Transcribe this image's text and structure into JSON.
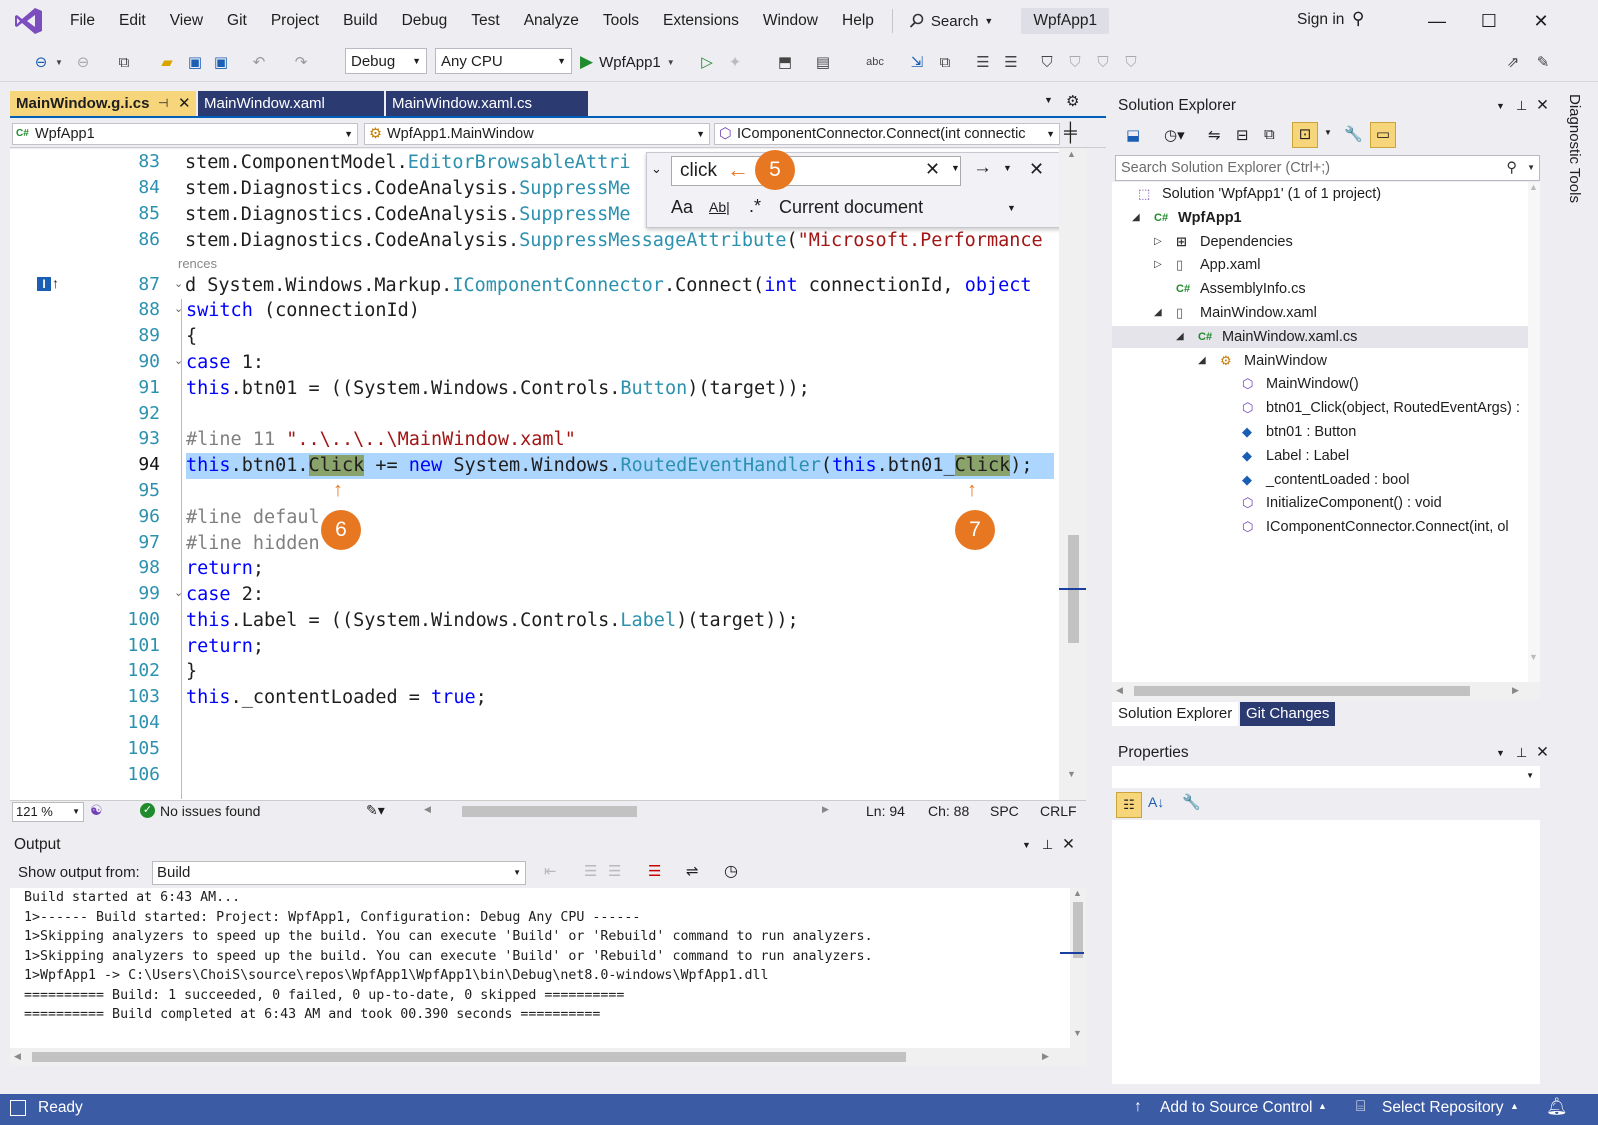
{
  "menubar": {
    "items": [
      "File",
      "Edit",
      "View",
      "Git",
      "Project",
      "Build",
      "Debug",
      "Test",
      "Analyze",
      "Tools",
      "Extensions",
      "Window",
      "Help"
    ],
    "search_label": "Search",
    "app_title": "WpfApp1",
    "sign_in": "Sign in"
  },
  "toolbar": {
    "config": "Debug",
    "platform": "Any CPU",
    "run_target": "WpfApp1"
  },
  "doc_tabs": [
    {
      "label": "MainWindow.g.i.cs",
      "active": true
    },
    {
      "label": "MainWindow.xaml",
      "active": false
    },
    {
      "label": "MainWindow.xaml.cs",
      "active": false
    }
  ],
  "nav": {
    "project": "WpfApp1",
    "type": "WpfApp1.MainWindow",
    "member": "IComponentConnector.Connect(int connectic"
  },
  "find": {
    "query": "click",
    "scope": "Current document"
  },
  "callouts": {
    "c5": "5",
    "c6": "6",
    "c7": "7"
  },
  "code": {
    "line_numbers": [
      "83",
      "84",
      "85",
      "86",
      "87",
      "88",
      "89",
      "90",
      "91",
      "92",
      "93",
      "94",
      "95",
      "96",
      "97",
      "98",
      "99",
      "100",
      "101",
      "102",
      "103",
      "104",
      "105",
      "106"
    ],
    "current_line": "94",
    "codelens": "rences",
    "l83a": "stem.ComponentModel.",
    "l83b": "EditorBrowsableAttri",
    "l84a": "stem.Diagnostics.CodeAnalysis.",
    "l84b": "SuppressMe",
    "l85a": "stem.Diagnostics.CodeAnalysis.",
    "l85b": "SuppressMe",
    "l86a": "stem.Diagnostics.CodeAnalysis.",
    "l86b": "SuppressMessageAttribute",
    "l86c": "(",
    "l86d": "\"Microsoft.Performance",
    "l87a": "d System.Windows.Markup.",
    "l87b": "IComponentConnector",
    "l87c": ".Connect(",
    "l87d": "int",
    "l87e": " connectionId, ",
    "l87f": "object",
    "l88a": "switch",
    "l88b": " (connectionId)",
    "l89": "{",
    "l90a": "case",
    "l90b": " 1:",
    "l91a": "this",
    "l91b": ".btn01 = ((System.Windows.Controls.",
    "l91c": "Button",
    "l91d": ")(target));",
    "l93a": "#line 11 ",
    "l93b": "\"..\\..\\..\\MainWindow.xaml\"",
    "l94a": "this",
    "l94b": ".btn01.",
    "l94c": "Click",
    "l94d": " += ",
    "l94e": "new",
    "l94f": " System.Windows.",
    "l94g": "RoutedEventHandler",
    "l94h": "(",
    "l94i": "this",
    "l94j": ".btn01_",
    "l94k": "Click",
    "l94l": ");",
    "l96": "#line defaul",
    "l97": "#line hidden",
    "l98a": "return",
    "l98b": ";",
    "l99a": "case",
    "l99b": " 2:",
    "l100a": "this",
    "l100b": ".Label = ((System.Windows.Controls.",
    "l100c": "Label",
    "l100d": ")(target));",
    "l101a": "return",
    "l101b": ";",
    "l102": "}",
    "l103a": "this",
    "l103b": "._contentLoaded = ",
    "l103c": "true",
    "l103d": ";"
  },
  "editor_status": {
    "zoom": "121 %",
    "issues": "No issues found",
    "ln": "Ln: 94",
    "ch": "Ch: 88",
    "spc": "SPC",
    "crlf": "CRLF"
  },
  "output": {
    "title": "Output",
    "show_from_label": "Show output from:",
    "source": "Build",
    "lines": [
      "Build started at 6:43 AM...",
      "1>------ Build started: Project: WpfApp1, Configuration: Debug Any CPU ------",
      "1>Skipping analyzers to speed up the build. You can execute 'Build' or 'Rebuild' command to run analyzers.",
      "1>Skipping analyzers to speed up the build. You can execute 'Build' or 'Rebuild' command to run analyzers.",
      "1>WpfApp1 -> C:\\Users\\ChoiS\\source\\repos\\WpfApp1\\WpfApp1\\bin\\Debug\\net8.0-windows\\WpfApp1.dll",
      "========== Build: 1 succeeded, 0 failed, 0 up-to-date, 0 skipped ==========",
      "========== Build completed at 6:43 AM and took 00.390 seconds =========="
    ]
  },
  "solution_explorer": {
    "title": "Solution Explorer",
    "search_placeholder": "Search Solution Explorer (Ctrl+;)",
    "items": [
      "Solution 'WpfApp1' (1 of 1 project)",
      "WpfApp1",
      "Dependencies",
      "App.xaml",
      "AssemblyInfo.cs",
      "MainWindow.xaml",
      "MainWindow.xaml.cs",
      "MainWindow",
      "MainWindow()",
      "btn01_Click(object, RoutedEventArgs) :",
      "btn01 : Button",
      "Label : Label",
      "_contentLoaded : bool",
      "InitializeComponent() : void",
      "IComponentConnector.Connect(int, ol"
    ],
    "tabs": [
      "Solution Explorer",
      "Git Changes"
    ]
  },
  "properties": {
    "title": "Properties"
  },
  "diagnostic_tools": "Diagnostic Tools",
  "statusbar": {
    "ready": "Ready",
    "add_source": "Add to Source Control",
    "select_repo": "Select Repository"
  }
}
